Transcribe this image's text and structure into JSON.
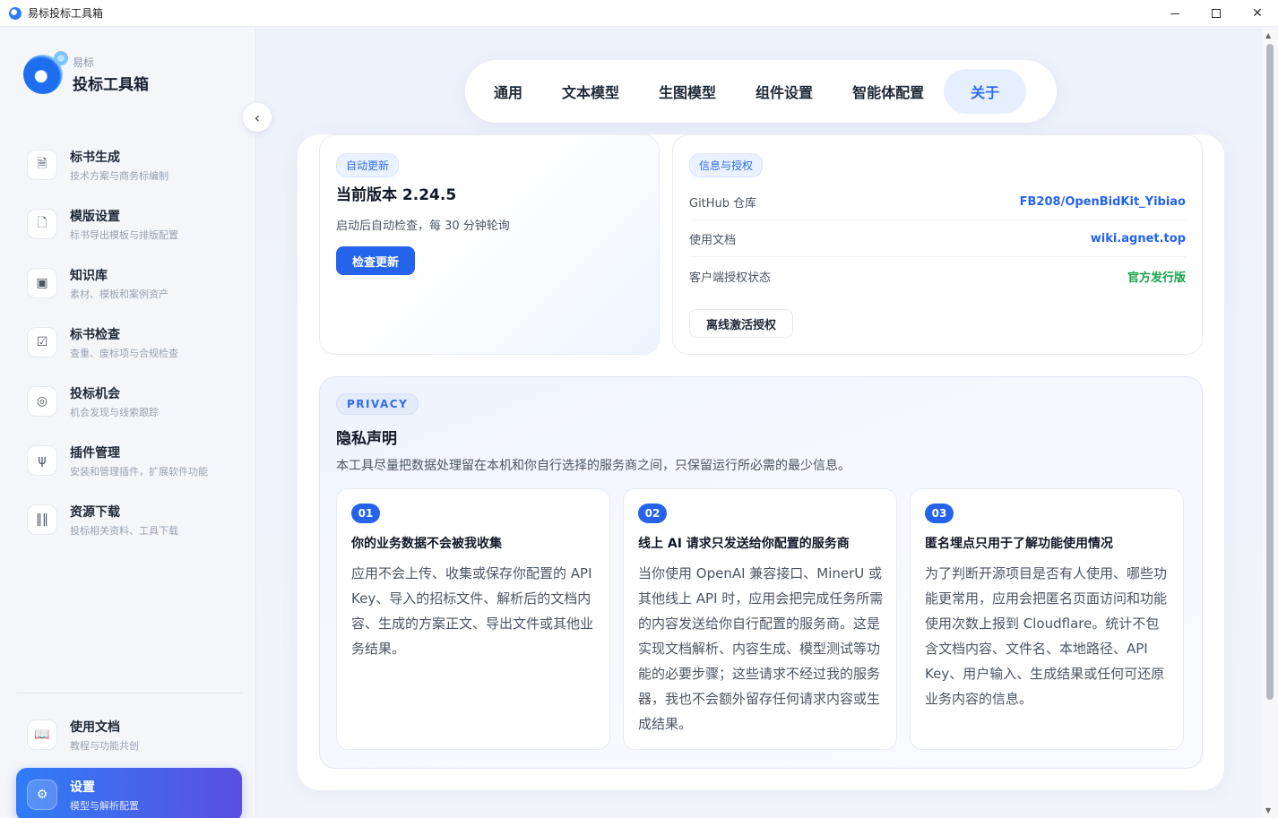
{
  "window": {
    "title": "易标投标工具箱",
    "controls": {
      "minimize": "—",
      "maximize": "□",
      "close": "✕"
    }
  },
  "brand": {
    "sub": "易标",
    "name": "投标工具箱"
  },
  "sidebar": {
    "collapse_icon": "chevron-left-icon",
    "items": [
      {
        "title": "标书生成",
        "desc": "技术方案与商务标编制",
        "icon": "document-icon"
      },
      {
        "title": "模版设置",
        "desc": "标书导出模板与排版配置",
        "icon": "file-icon"
      },
      {
        "title": "知识库",
        "desc": "素材、模板和案例资产",
        "icon": "archive-icon"
      },
      {
        "title": "标书检查",
        "desc": "查重、废标项与合规检查",
        "icon": "checklist-icon"
      },
      {
        "title": "投标机会",
        "desc": "机会发现与线索跟踪",
        "icon": "target-icon"
      },
      {
        "title": "插件管理",
        "desc": "安装和管理插件，扩展软件功能",
        "icon": "plug-icon"
      },
      {
        "title": "资源下载",
        "desc": "投标相关资料、工具下载",
        "icon": "books-icon"
      }
    ],
    "bottom": [
      {
        "title": "使用文档",
        "desc": "教程与功能共创",
        "icon": "book-icon"
      },
      {
        "title": "设置",
        "desc": "模型与解析配置",
        "icon": "gear-icon",
        "active": true
      }
    ]
  },
  "tabs": [
    "通用",
    "文本模型",
    "生图模型",
    "组件设置",
    "智能体配置",
    "关于"
  ],
  "active_tab": "关于",
  "update": {
    "badge": "自动更新",
    "version": "当前版本 2.24.5",
    "note": "启动后自动检查，每 30 分钟轮询",
    "button": "检查更新"
  },
  "info": {
    "badge": "信息与授权",
    "rows": [
      {
        "key": "GitHub 仓库",
        "value": "FB208/OpenBidKit_Yibiao"
      },
      {
        "key": "使用文档",
        "value": "wiki.agnet.top"
      },
      {
        "key": "客户端授权状态",
        "value": "官方发行版"
      }
    ],
    "button": "离线激活授权"
  },
  "privacy": {
    "badge": "PRIVACY",
    "title": "隐私声明",
    "subtitle": "本工具尽量把数据处理留在本机和你自行选择的服务商之间，只保留运行所必需的最少信息。",
    "cards": [
      {
        "num": "01",
        "title": "你的业务数据不会被我收集",
        "body": "应用不会上传、收集或保存你配置的 API Key、导入的招标文件、解析后的文档内容、生成的方案正文、导出文件或其他业务结果。"
      },
      {
        "num": "02",
        "title": "线上 AI 请求只发送给你配置的服务商",
        "body": "当你使用 OpenAI 兼容接口、MinerU 或其他线上 API 时，应用会把完成任务所需的内容发送给你自行配置的服务商。这是实现文档解析、内容生成、模型测试等功能的必要步骤；这些请求不经过我的服务器，我也不会额外留存任何请求内容或生成结果。"
      },
      {
        "num": "03",
        "title": "匿名埋点只用于了解功能使用情况",
        "body": "为了判断开源项目是否有人使用、哪些功能更常用，应用会把匿名页面访问和功能使用次数上报到 Cloudflare。统计不包含文档内容、文件名、本地路径、API Key、用户输入、生成结果或任何可还原业务内容的信息。"
      }
    ]
  }
}
